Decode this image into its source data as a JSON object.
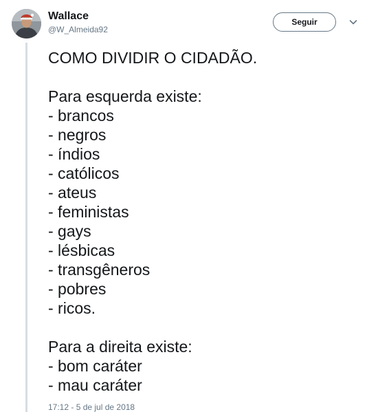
{
  "author": {
    "display_name": "Wallace",
    "handle": "@W_Almeida92",
    "avatar_icon": "profile-photo"
  },
  "header": {
    "follow_label": "Seguir",
    "menu_icon": "chevron-down-icon"
  },
  "tweet": {
    "title": "COMO DIVIDIR O CIDADÃO.",
    "left_heading": "Para esquerda existe:",
    "left_items": [
      "- brancos",
      "- negros",
      "- índios",
      "- católicos",
      "- ateus",
      "- feministas",
      "- gays",
      "- lésbicas",
      "- transgêneros",
      "- pobres",
      "- ricos."
    ],
    "right_heading": "Para a direita existe:",
    "right_items": [
      "- bom caráter",
      "- mau caráter"
    ],
    "timestamp": "17:12 - 5 de jul de 2018"
  },
  "colors": {
    "text_primary": "#14171a",
    "text_secondary": "#657786",
    "thread_line": "#d7dde2",
    "button_border": "#657786"
  }
}
